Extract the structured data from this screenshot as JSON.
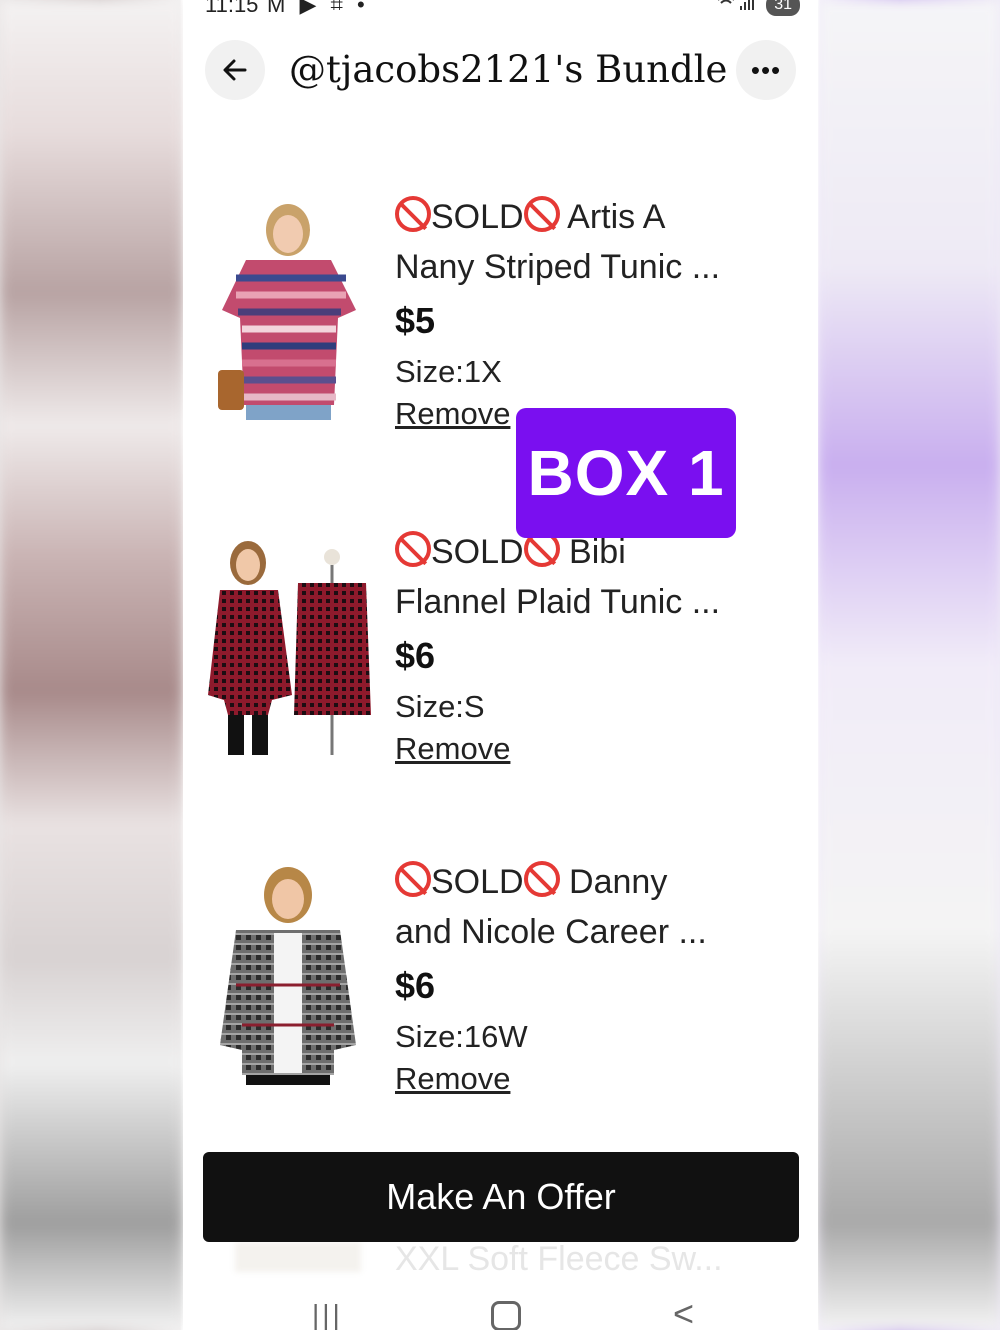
{
  "status_bar": {
    "time": "11:15",
    "left_icons": "M ▶ ⌗ •",
    "signal": "📶",
    "battery": "31"
  },
  "header": {
    "back_icon": "arrow-left-icon",
    "title": "@tjacobs2121's Bundle",
    "more_icon": "more-horizontal-icon"
  },
  "items": [
    {
      "sold_prefix": "SOLD",
      "name_line1": "Artis A",
      "name_line2": "Nany Striped Tunic ...",
      "price": "$5",
      "size": "Size:1X",
      "remove": "Remove"
    },
    {
      "sold_prefix": "SOLD",
      "name_line1": "Bibi",
      "name_line2": "Flannel Plaid Tunic ...",
      "price": "$6",
      "size": "Size:S",
      "remove": "Remove"
    },
    {
      "sold_prefix": "SOLD",
      "name_line1": "Danny",
      "name_line2": "and Nicole  Career ...",
      "price": "$6",
      "size": "Size:16W",
      "remove": "Remove"
    }
  ],
  "overlay_label": "BOX 1",
  "offer_button": "Make An Offer",
  "peek_text": "XXL Soft Fleece Sw...",
  "colors": {
    "accent_overlay": "#7a0ff0",
    "sold_icon": "#e53935",
    "button_bg": "#111111"
  }
}
